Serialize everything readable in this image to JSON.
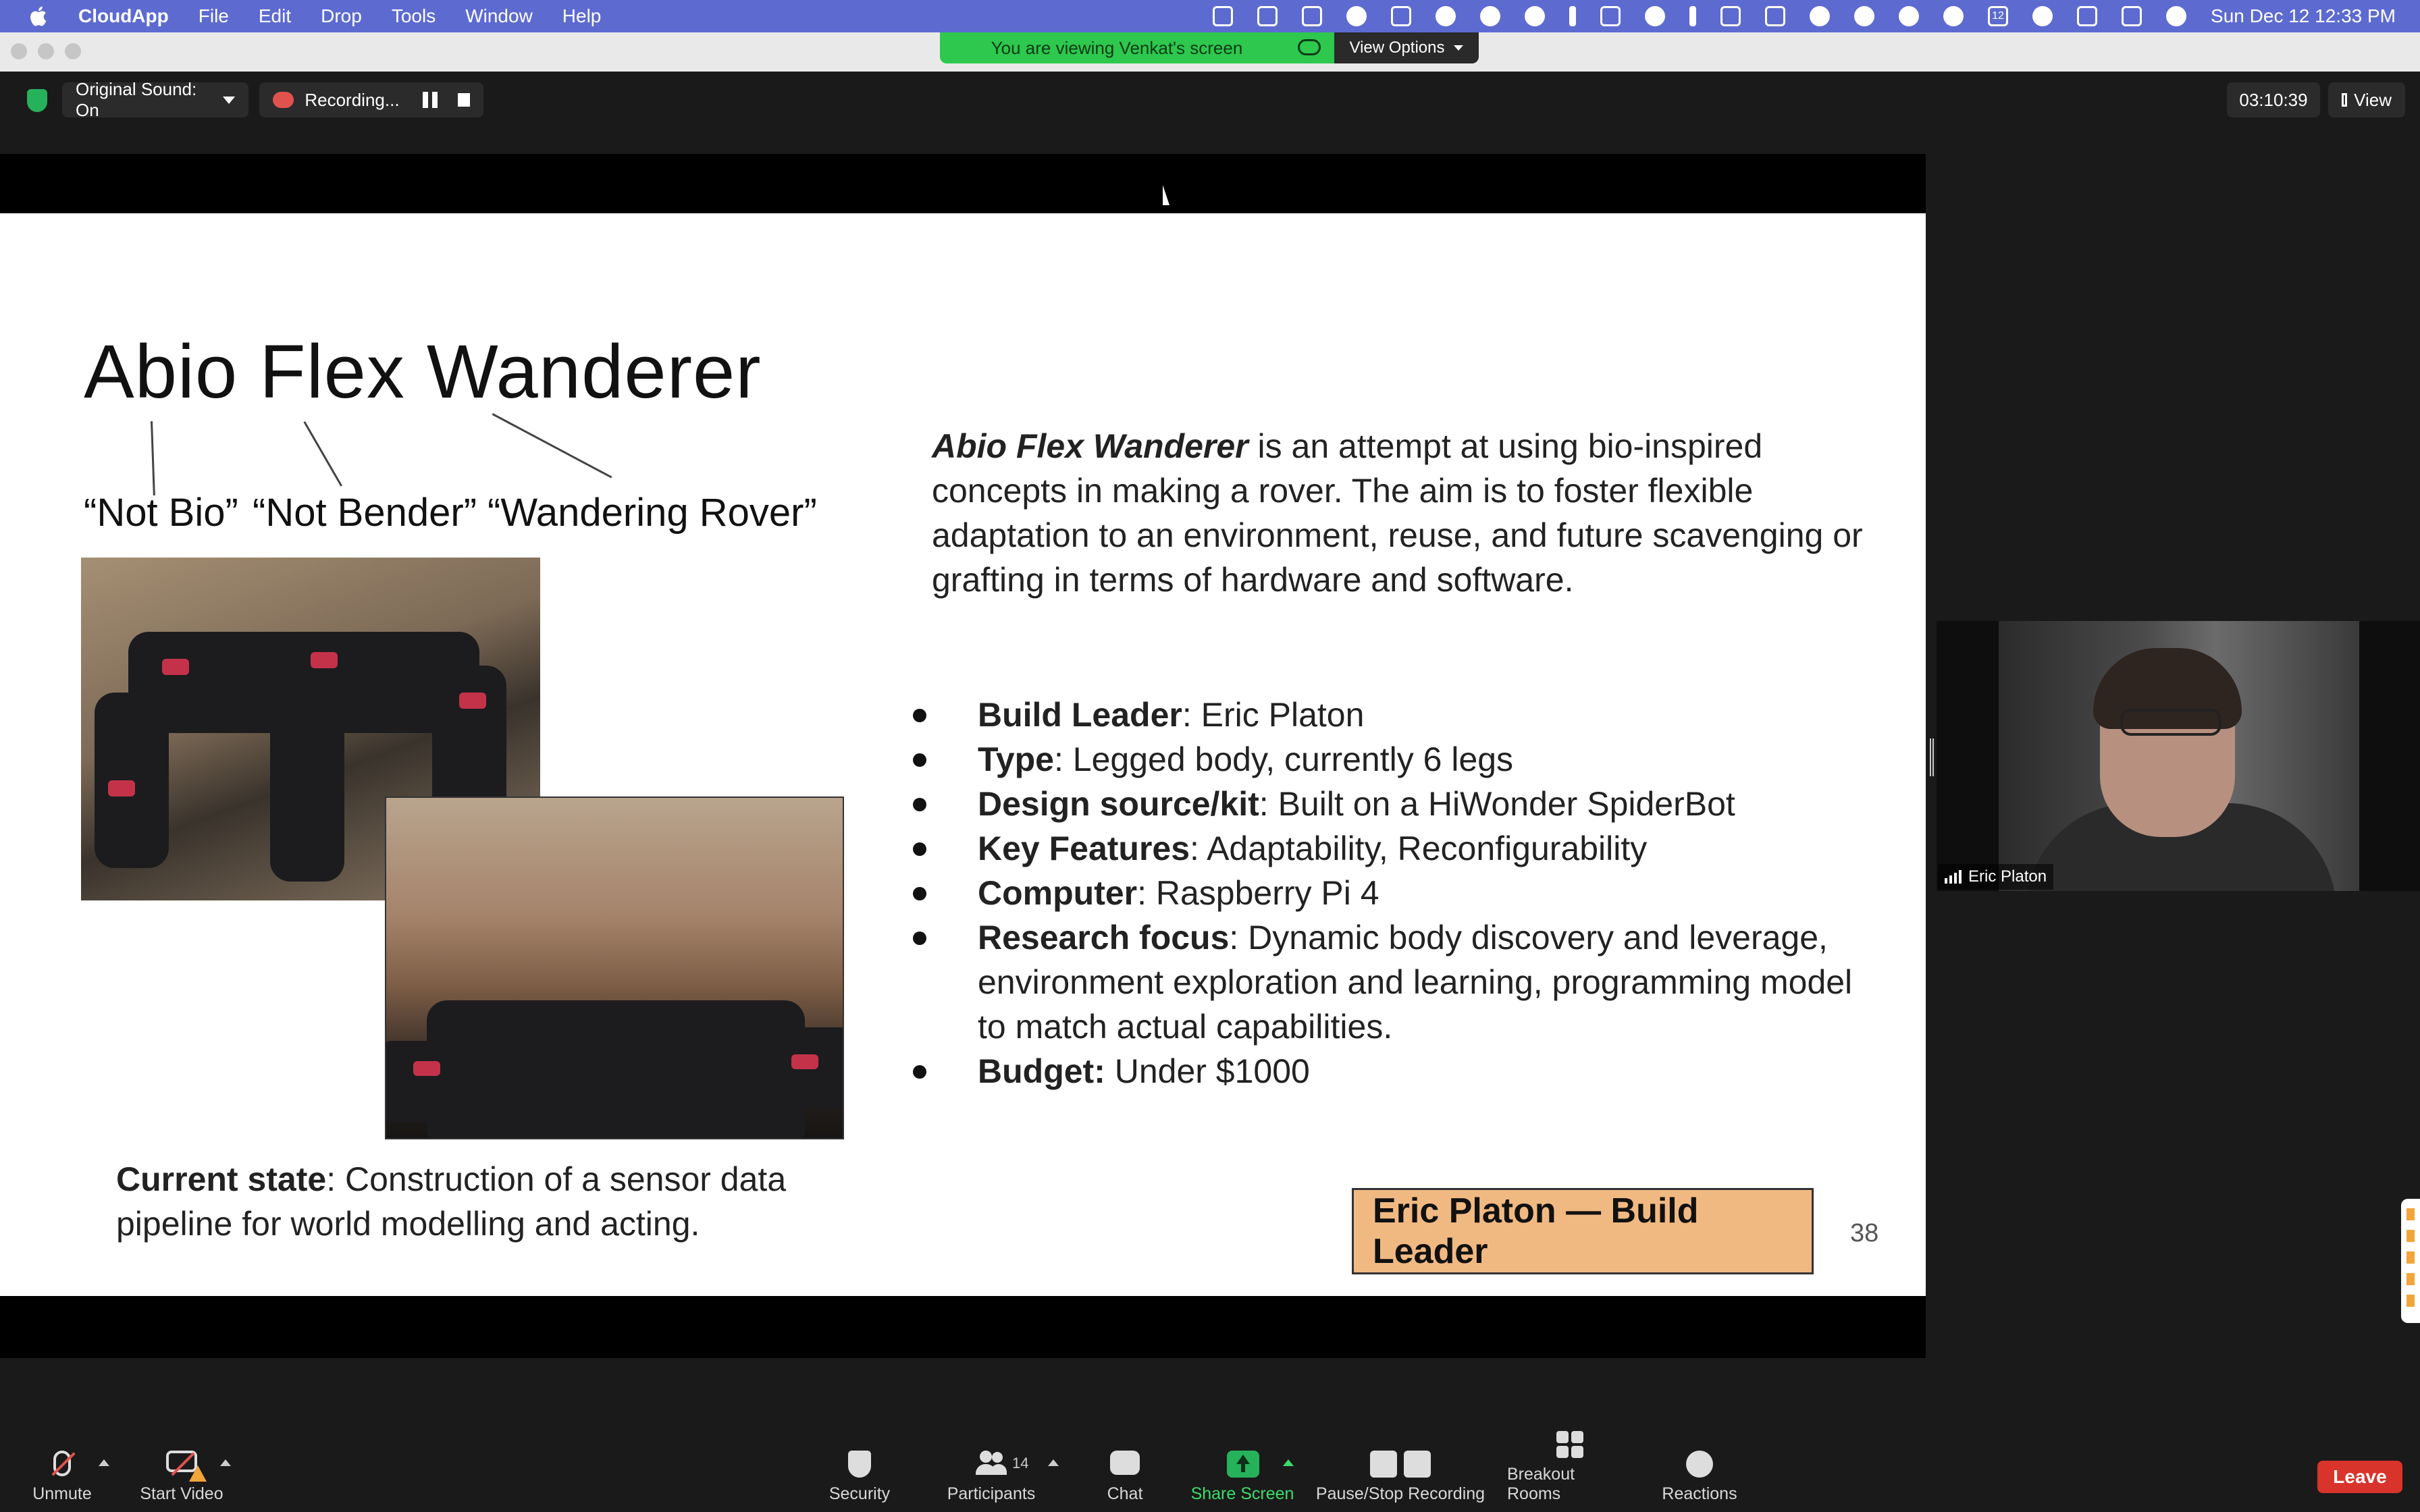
{
  "menubar": {
    "app_name": "CloudApp",
    "menus": [
      "File",
      "Edit",
      "Drop",
      "Tools",
      "Window",
      "Help"
    ],
    "datetime": "Sun Dec 12  12:33 PM",
    "calendar_day": "12"
  },
  "share_banner": {
    "text": "You are viewing Venkat's screen",
    "view_options": "View Options"
  },
  "topbar": {
    "original_sound": "Original Sound: On",
    "recording": "Recording...",
    "timer": "03:10:39",
    "view": "View"
  },
  "slide": {
    "title": "Abio Flex Wanderer",
    "subtitles": [
      "“Not Bio”",
      "“Not Bender”",
      "“Wandering Rover”"
    ],
    "intro_bold": "Abio Flex Wanderer",
    "intro_rest": " is an attempt at using bio-inspired concepts in making a rover. The aim is to foster flexible adaptation to an environment, reuse, and future scavenging or grafting in terms of hardware and software.",
    "bullets": [
      {
        "label": "Build Leader",
        "text": ": Eric Platon"
      },
      {
        "label": "Type",
        "text": ": Legged body, currently 6 legs"
      },
      {
        "label": "Design source/kit",
        "text": ": Built on a HiWonder SpiderBot"
      },
      {
        "label": "Key Features",
        "text": ": Adaptability, Reconfigurability"
      },
      {
        "label": "Computer",
        "text": ": Raspberry Pi 4"
      },
      {
        "label": "Research focus",
        "text": ": Dynamic body discovery and leverage, environment exploration and learning, programming model to match actual capabilities."
      },
      {
        "label": "Budget:",
        "text": " Under $1000"
      }
    ],
    "current_label": "Current state",
    "current_text": ": Construction of a sensor data pipeline for world modelling and acting.",
    "name_box": "Eric Platon — Build Leader",
    "page_number": "38"
  },
  "participant": {
    "name": "Eric Platon"
  },
  "toolbar": {
    "unmute": "Unmute",
    "start_video": "Start Video",
    "security": "Security",
    "participants": "Participants",
    "participants_count": "14",
    "chat": "Chat",
    "share_screen": "Share Screen",
    "pause_stop_recording": "Pause/Stop Recording",
    "breakout_rooms": "Breakout Rooms",
    "reactions": "Reactions",
    "leave": "Leave"
  },
  "colors": {
    "menubar": "#5d6bd0",
    "banner_green": "#2dc84d",
    "name_box": "#f1b982",
    "leave_red": "#d9342b"
  }
}
